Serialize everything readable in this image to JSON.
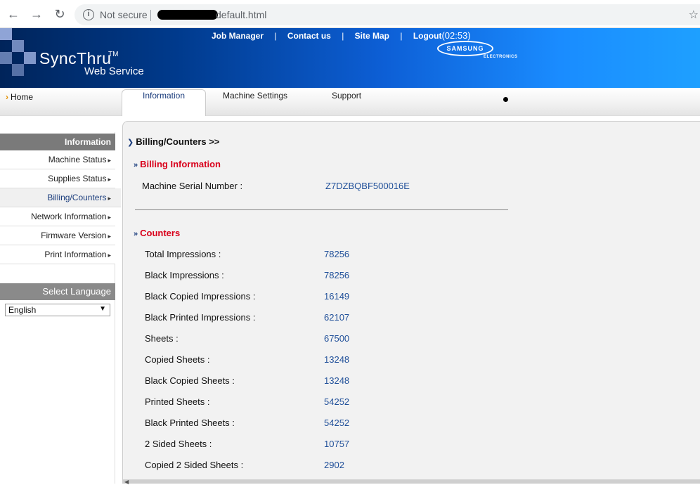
{
  "browser": {
    "not_secure": "Not secure",
    "url": "default.html",
    "back_icon": "arrow-left-icon",
    "forward_icon": "arrow-right-icon",
    "reload_icon": "reload-icon"
  },
  "header": {
    "brand": "SyncThru",
    "tm": "TM",
    "brand_sub": "Web Service",
    "links": {
      "job_manager": "Job Manager",
      "contact_us": "Contact us",
      "site_map": "Site Map",
      "logout": "Logout",
      "timer": "(02:53)",
      "sep": "|"
    },
    "samsung": "SAMSUNG",
    "electronics": "ELECTRONICS"
  },
  "tabs": {
    "home": "Home",
    "information": "Information",
    "machine_settings": "Machine Settings",
    "support": "Support"
  },
  "sidebar": {
    "heading": "Information",
    "items": [
      {
        "label": "Machine Status"
      },
      {
        "label": "Supplies Status"
      },
      {
        "label": "Billing/Counters"
      },
      {
        "label": "Network Information"
      },
      {
        "label": "Firmware Version"
      },
      {
        "label": "Print Information"
      }
    ],
    "lang_heading": "Select Language",
    "lang_value": "English"
  },
  "content": {
    "breadcrumb": "Billing/Counters >>",
    "billing_title": "Billing Information",
    "serial_label": "Machine Serial Number :",
    "serial_value": "Z7DZBQBF500016E",
    "counters_title": "Counters",
    "counters": [
      {
        "label": "Total Impressions  :",
        "value": "78256"
      },
      {
        "label": "Black Impressions  :",
        "value": "78256"
      },
      {
        "label": "Black Copied Impressions  :",
        "value": "16149"
      },
      {
        "label": "Black Printed Impressions  :",
        "value": "62107"
      },
      {
        "label": "Sheets  :",
        "value": "67500"
      },
      {
        "label": "Copied Sheets  :",
        "value": "13248"
      },
      {
        "label": "Black Copied Sheets  :",
        "value": "13248"
      },
      {
        "label": "Printed Sheets  :",
        "value": "54252"
      },
      {
        "label": "Black Printed Sheets  :",
        "value": "54252"
      },
      {
        "label": "2 Sided Sheets  :",
        "value": "10757"
      },
      {
        "label": "Copied 2 Sided Sheets  :",
        "value": "2902"
      }
    ]
  },
  "colors": {
    "banner_dark": "#00245a",
    "banner_light": "#1ea0ff",
    "accent_red": "#d9001b",
    "value_blue": "#1f4f99"
  }
}
